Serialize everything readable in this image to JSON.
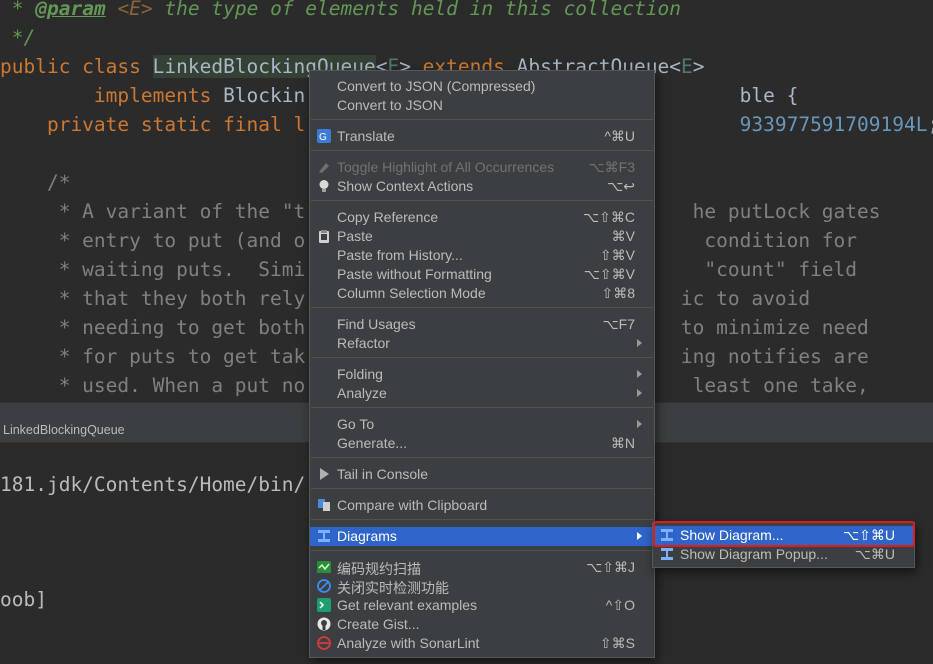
{
  "editor": {
    "lines": [
      {
        "parts": [
          [
            "cmt",
            " * "
          ],
          [
            "cmt-tag",
            "@param"
          ],
          [
            "cmt",
            " "
          ],
          [
            "cmt-gen",
            "<E>"
          ],
          [
            "cmt",
            " the type of elements held in this collection"
          ]
        ]
      },
      {
        "parts": [
          [
            "cmt",
            " */"
          ]
        ]
      },
      {
        "parts": [
          [
            "kw",
            "public class "
          ],
          [
            "ident-hl",
            "LinkedBlockingQueue"
          ],
          [
            "typ",
            "<"
          ],
          [
            "gen",
            "E"
          ],
          [
            "typ",
            "> "
          ],
          [
            "kw",
            "extends "
          ],
          [
            "typ",
            "AbstractQueue<"
          ],
          [
            "gen",
            "E"
          ],
          [
            "typ",
            ">"
          ]
        ]
      },
      {
        "parts": [
          [
            "kw",
            "        implements "
          ],
          [
            "typ",
            "Blockin"
          ],
          [
            "typ",
            "                                     ble {"
          ]
        ]
      },
      {
        "parts": [
          [
            "kw",
            "    private static final l"
          ],
          [
            "num",
            "                                     933977591709194L"
          ],
          [
            "typ",
            ";"
          ]
        ]
      },
      {
        "parts": [
          [
            "typ",
            ""
          ]
        ]
      },
      {
        "parts": [
          [
            "blk-comment",
            "    /*"
          ]
        ]
      },
      {
        "parts": [
          [
            "blk-comment",
            "     * A variant of the \"t"
          ],
          [
            "blk-comment",
            "                                 he putLock gates"
          ]
        ]
      },
      {
        "parts": [
          [
            "blk-comment",
            "     * entry to put (and o"
          ],
          [
            "blk-comment",
            "                                  condition for"
          ]
        ]
      },
      {
        "parts": [
          [
            "blk-comment",
            "     * waiting puts.  Simi"
          ],
          [
            "blk-comment",
            "                                  \"count\" field"
          ]
        ]
      },
      {
        "parts": [
          [
            "blk-comment",
            "     * that they both rely"
          ],
          [
            "blk-comment",
            "                                ic to avoid"
          ]
        ]
      },
      {
        "parts": [
          [
            "blk-comment",
            "     * needing to get both"
          ],
          [
            "blk-comment",
            "                                to minimize need"
          ]
        ]
      },
      {
        "parts": [
          [
            "blk-comment",
            "     * for puts to get tak"
          ],
          [
            "blk-comment",
            "                                ing notifies are"
          ]
        ]
      },
      {
        "parts": [
          [
            "blk-comment",
            "     * used. When a put no"
          ],
          [
            "blk-comment",
            "                                 least one take,"
          ]
        ]
      }
    ]
  },
  "run_tab": {
    "label": "LinkedBlockingQueue"
  },
  "console": {
    "line1": "181.jdk/Contents/Home/bin/",
    "line2": "oob]"
  },
  "context_menu": {
    "items": [
      {
        "name": "convert-json-compressed",
        "label": "Convert to JSON (Compressed)",
        "shortcut": "",
        "icon": "",
        "disabled": false,
        "submenu": false
      },
      {
        "name": "convert-json",
        "label": "Convert to JSON",
        "shortcut": "",
        "icon": "",
        "disabled": false,
        "submenu": false
      },
      {
        "name": "translate",
        "label": "Translate",
        "shortcut": "^⌘U",
        "icon": "translate-icon",
        "disabled": false,
        "submenu": false
      },
      {
        "name": "toggle-highlight",
        "label": "Toggle Highlight of All Occurrences",
        "shortcut": "⌥⌘F3",
        "icon": "highlighter-icon",
        "disabled": true,
        "submenu": false
      },
      {
        "name": "show-context-actions",
        "label": "Show Context Actions",
        "shortcut": "⌥↩",
        "icon": "lightbulb-icon",
        "disabled": false,
        "submenu": false
      },
      {
        "name": "copy-reference",
        "label": "Copy Reference",
        "shortcut": "⌥⇧⌘C",
        "icon": "",
        "disabled": false,
        "submenu": false
      },
      {
        "name": "paste",
        "label": "Paste",
        "shortcut": "⌘V",
        "icon": "clipboard-icon",
        "disabled": false,
        "submenu": false
      },
      {
        "name": "paste-from-history",
        "label": "Paste from History...",
        "shortcut": "⇧⌘V",
        "icon": "",
        "disabled": false,
        "submenu": false
      },
      {
        "name": "paste-without-formatting",
        "label": "Paste without Formatting",
        "shortcut": "⌥⇧⌘V",
        "icon": "",
        "disabled": false,
        "submenu": false
      },
      {
        "name": "column-selection-mode",
        "label": "Column Selection Mode",
        "shortcut": "⇧⌘8",
        "icon": "",
        "disabled": false,
        "submenu": false
      },
      {
        "name": "find-usages",
        "label": "Find Usages",
        "shortcut": "⌥F7",
        "icon": "",
        "disabled": false,
        "submenu": false
      },
      {
        "name": "refactor",
        "label": "Refactor",
        "shortcut": "",
        "icon": "",
        "disabled": false,
        "submenu": true
      },
      {
        "name": "folding",
        "label": "Folding",
        "shortcut": "",
        "icon": "",
        "disabled": false,
        "submenu": true
      },
      {
        "name": "analyze",
        "label": "Analyze",
        "shortcut": "",
        "icon": "",
        "disabled": false,
        "submenu": true
      },
      {
        "name": "go-to",
        "label": "Go To",
        "shortcut": "",
        "icon": "",
        "disabled": false,
        "submenu": true
      },
      {
        "name": "generate",
        "label": "Generate...",
        "shortcut": "⌘N",
        "icon": "",
        "disabled": false,
        "submenu": false
      },
      {
        "name": "tail-in-console",
        "label": "Tail in Console",
        "shortcut": "",
        "icon": "play-icon",
        "disabled": false,
        "submenu": false
      },
      {
        "name": "compare-clipboard",
        "label": "Compare with Clipboard",
        "shortcut": "",
        "icon": "compare-icon",
        "disabled": false,
        "submenu": false
      },
      {
        "name": "diagrams",
        "label": "Diagrams",
        "shortcut": "",
        "icon": "diagram-icon",
        "disabled": false,
        "submenu": true,
        "selected": true
      },
      {
        "name": "code-scan",
        "label": "编码规约扫描",
        "shortcut": "⌥⇧⌘J",
        "icon": "scan-icon",
        "disabled": false,
        "submenu": false
      },
      {
        "name": "realtime-detect",
        "label": "关闭实时检测功能",
        "shortcut": "",
        "icon": "no-entry-icon",
        "disabled": false,
        "submenu": false
      },
      {
        "name": "relevant-examples",
        "label": "Get relevant examples",
        "shortcut": "^⇧O",
        "icon": "terminal-icon",
        "disabled": false,
        "submenu": false
      },
      {
        "name": "create-gist",
        "label": "Create Gist...",
        "shortcut": "",
        "icon": "github-icon",
        "disabled": false,
        "submenu": false
      },
      {
        "name": "sonarlint",
        "label": "Analyze with SonarLint",
        "shortcut": "⇧⌘S",
        "icon": "sonarlint-icon",
        "disabled": false,
        "submenu": false
      }
    ]
  },
  "diagrams_submenu": {
    "items": [
      {
        "name": "show-diagram",
        "label": "Show Diagram...",
        "shortcut": "⌥⇧⌘U",
        "icon": "diagram-icon",
        "selected": true
      },
      {
        "name": "show-diagram-popup",
        "label": "Show Diagram Popup...",
        "shortcut": "⌥⌘U",
        "icon": "diagram-icon",
        "selected": false
      }
    ]
  },
  "colors": {
    "accent": "#2f65ca",
    "highlight_box": "#e01b1b",
    "menu_bg": "#3c3f41"
  }
}
